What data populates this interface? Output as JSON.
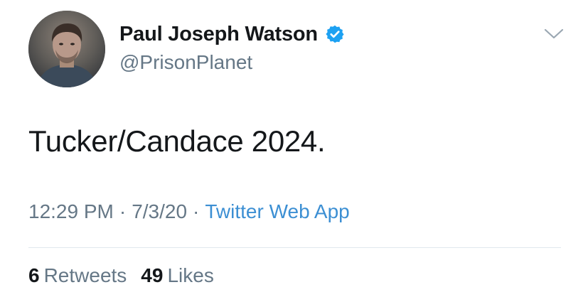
{
  "tweet": {
    "author": {
      "display_name": "Paul Joseph Watson",
      "handle": "@PrisonPlanet",
      "verified": true
    },
    "text": "Tucker/Candace 2024.",
    "meta": {
      "time": "12:29 PM",
      "separator": "·",
      "date": "7/3/20",
      "source": "Twitter Web App"
    },
    "stats": {
      "retweets_count": "6",
      "retweets_label": "Retweets",
      "likes_count": "49",
      "likes_label": "Likes"
    }
  },
  "icons": {
    "verified": "verified-badge-icon",
    "caret": "chevron-down-icon"
  },
  "colors": {
    "text_primary": "#14171a",
    "text_secondary": "#657786",
    "link": "#3c8fd3",
    "verified": "#1da1f2",
    "divider": "#e1e8ed"
  }
}
